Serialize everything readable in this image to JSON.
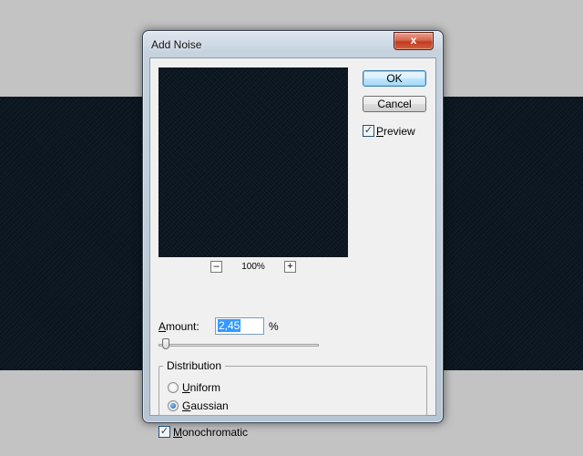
{
  "dialog": {
    "title": "Add Noise",
    "close_glyph": "x"
  },
  "buttons": {
    "ok_label": "OK",
    "cancel_label": "Cancel"
  },
  "preview": {
    "label_mnemonic": "P",
    "label_rest": "review",
    "checked": true
  },
  "zoom": {
    "minus": "–",
    "plus": "+",
    "level": "100%"
  },
  "amount": {
    "label_mnemonic": "A",
    "label_rest": "mount:",
    "value": "2,45",
    "unit": "%"
  },
  "distribution": {
    "legend": "Distribution",
    "options": [
      {
        "mnemonic": "U",
        "rest": "niform",
        "selected": false
      },
      {
        "mnemonic": "G",
        "rest": "aussian",
        "selected": true
      }
    ]
  },
  "monochromatic": {
    "label_mnemonic": "M",
    "label_rest": "onochromatic",
    "checked": true
  },
  "check_glyph": "✓",
  "colors": {
    "canvas": "#0c1722",
    "desktop": "#c3c3c3",
    "selection": "#3399ff"
  }
}
